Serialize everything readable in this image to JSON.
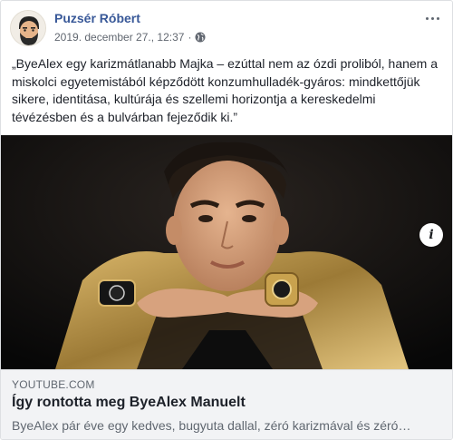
{
  "post": {
    "author": "Puzsér Róbert",
    "timestamp": "2019. december 27., 12:37",
    "separator": "·",
    "privacy_icon": "globe-icon",
    "more_icon": "more-options-icon",
    "text": "„ByeAlex egy karizmátlanabb Majka – ezúttal nem az ózdi proliból, hanem a miskolci egyetemistából képződött konzumhulladék-gyáros: mindkettőjük sikere, identitása, kultúrája és szellemi horizontja a kereskedelmi tévézésben és a bulvárban fejeződik ki.”"
  },
  "link_preview": {
    "domain": "YOUTUBE.COM",
    "title": "Így rontotta meg ByeAlex Manuelt",
    "description": "ByeAlex pár éve egy kedves, bugyuta dallal, zéró karizmával és zéró…",
    "info_icon": "info-icon",
    "info_label": "i"
  },
  "colors": {
    "author_link": "#385898",
    "meta_gray": "#616770",
    "link_box_bg": "#f2f3f5",
    "jacket_gold": "#b8954a"
  }
}
